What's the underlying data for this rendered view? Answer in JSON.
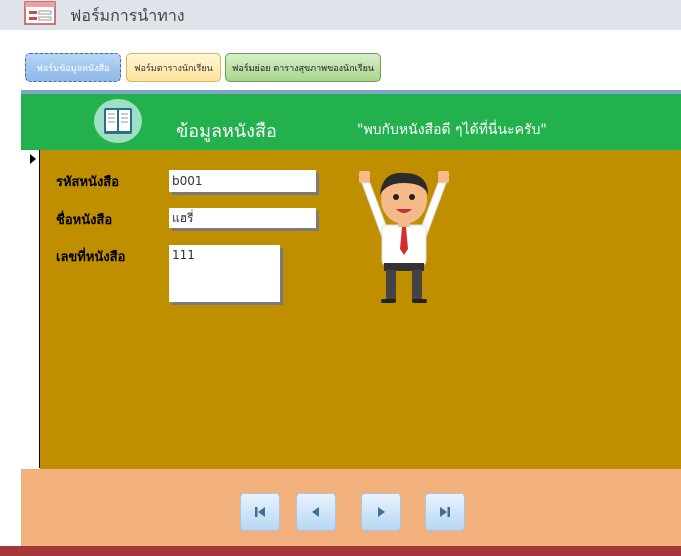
{
  "window": {
    "title": "ฟอร์มการนำทาง"
  },
  "tabs": [
    {
      "label": "ฟอร์มข้อมูลหนังสือ"
    },
    {
      "label": "ฟอร์มตารางนักเรียน"
    },
    {
      "label": "ฟอร์มย่อย ตารางสุขภาพของนักเรียน"
    }
  ],
  "header": {
    "title": "ข้อมูลหนังสือ",
    "subtitle": "\"พบกับหนังสือดี ๆได้ที่นี่นะครับ\""
  },
  "form": {
    "book_id_label": "รหัสหนังสือ",
    "book_id_value": "b001",
    "book_name_label": "ชื่อหนังสือ",
    "book_name_value": "แฮรี่",
    "book_number_label": "เลขที่หนังสือ",
    "book_number_value": "111"
  },
  "navigation": {
    "first": "first-record-icon",
    "previous": "previous-record-icon",
    "next": "next-record-icon",
    "last": "last-record-icon"
  },
  "colors": {
    "header": "#22b14c",
    "detail": "#bf8f00",
    "footer": "#f2b07c",
    "bottom_bar": "#a4373a"
  }
}
